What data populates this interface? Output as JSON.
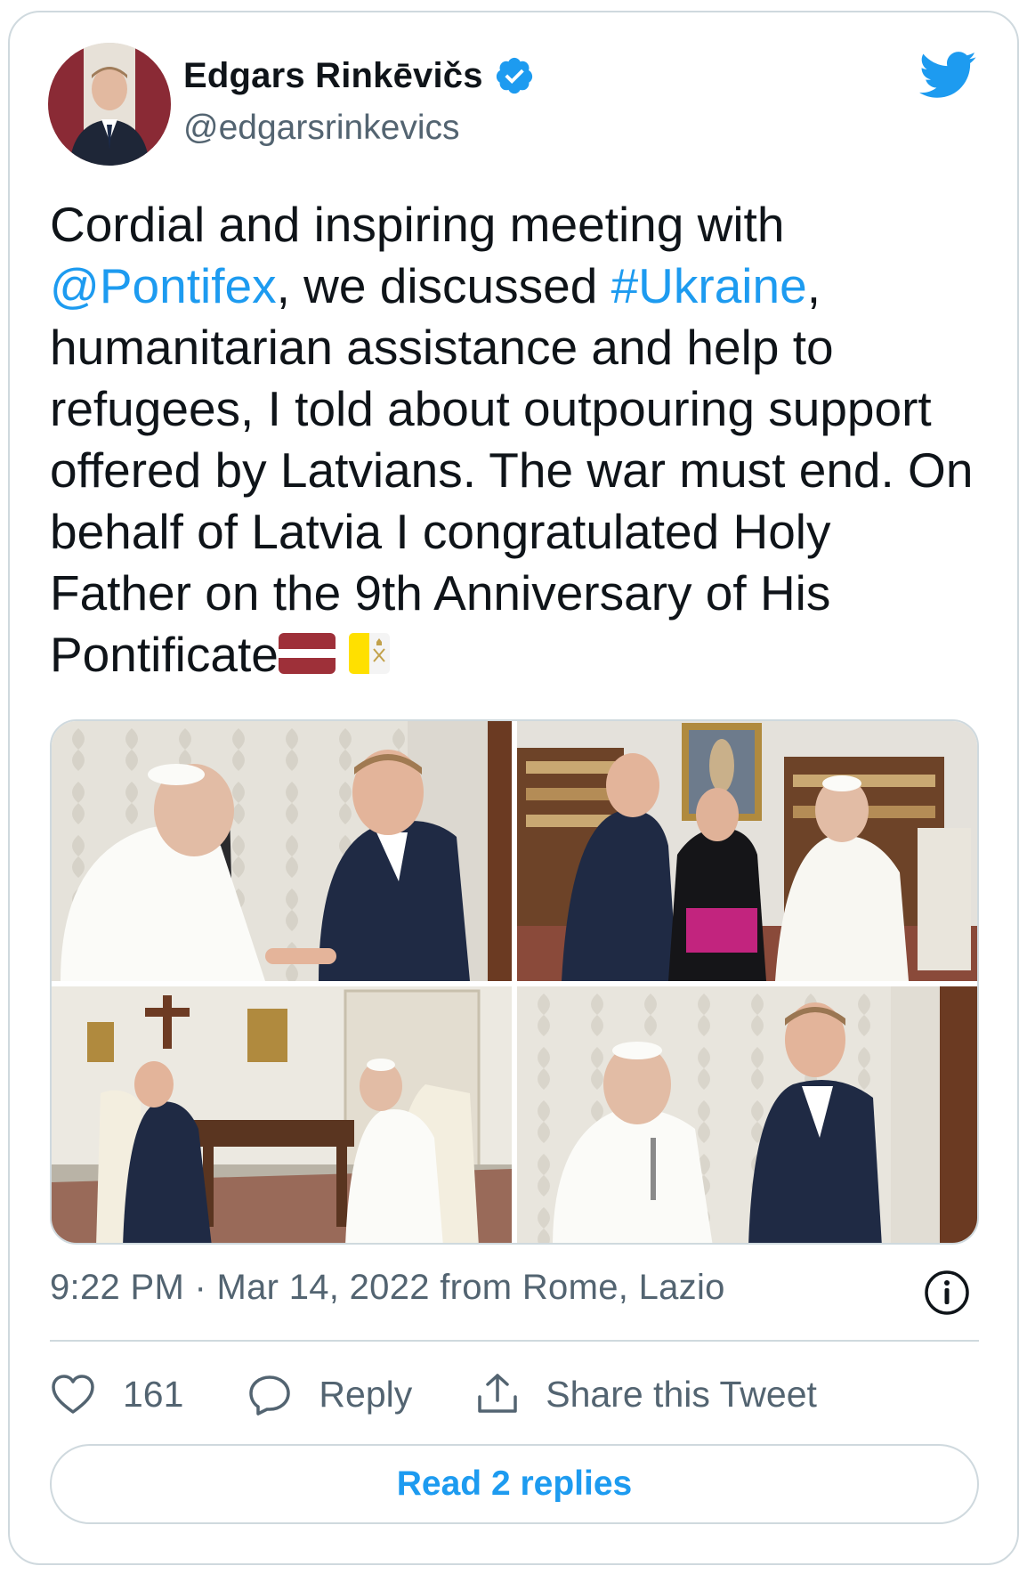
{
  "author": {
    "name": "Edgars Rinkēvičs",
    "handle": "@edgarsrinkevics",
    "verified": true
  },
  "tweet": {
    "segments": {
      "s1": "Cordial and inspiring meeting with ",
      "mention": "@Pontifex",
      "s2": ", we discussed ",
      "hashtag": "#Ukraine",
      "s3": ", humanitarian assistance and help to refugees, I told about outpouring support offered by Latvians. The war must end. On behalf of Latvia I congratulated Holy Father on the 9th Anniversary of His Pontificate"
    },
    "emoji": [
      "latvia-flag",
      "vatican-flag"
    ]
  },
  "media": {
    "photos": [
      "photo-1",
      "photo-2",
      "photo-3",
      "photo-4"
    ]
  },
  "meta": {
    "timestamp": "9:22 PM · Mar 14, 2022 from Rome, Lazio"
  },
  "actions": {
    "likes": "161",
    "reply_label": "Reply",
    "share_label": "Share this Tweet"
  },
  "read_replies_label": "Read 2 replies",
  "colors": {
    "link": "#1d9bf0",
    "text": "#0f1419",
    "secondary": "#536471",
    "border": "#cfd9de"
  }
}
